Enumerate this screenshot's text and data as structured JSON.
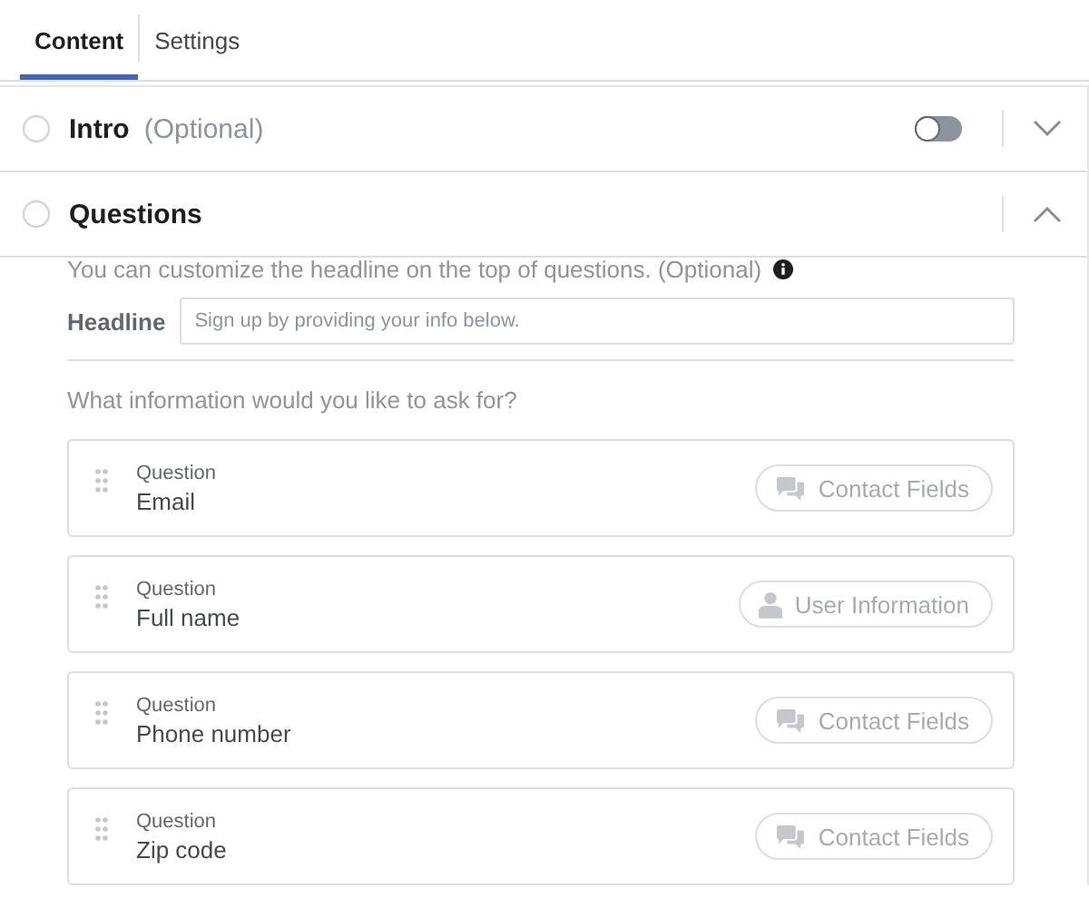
{
  "tabs": [
    {
      "label": "Content",
      "selected": true
    },
    {
      "label": "Settings",
      "selected": false
    }
  ],
  "sections": [
    {
      "title": "Intro",
      "note": "(Optional)",
      "toggle": {
        "on": false
      },
      "expanded": false
    },
    {
      "title": "Questions",
      "expanded": true
    }
  ],
  "questions_panel": {
    "description": "You can customize the headline on the top of questions. (Optional)",
    "headline_label": "Headline",
    "headline_placeholder": "Sign up by providing your info below.",
    "prompt": "What information would you like to ask for?",
    "questions": [
      {
        "label": "Question",
        "value": "Email",
        "tag": "Contact Fields",
        "kind": "chat"
      },
      {
        "label": "Question",
        "value": "Full name",
        "tag": "User Information",
        "kind": "user"
      },
      {
        "label": "Question",
        "value": "Phone number",
        "tag": "Contact Fields",
        "kind": "chat"
      },
      {
        "label": "Question",
        "value": "Zip code",
        "tag": "Contact Fields",
        "kind": "chat"
      }
    ]
  }
}
